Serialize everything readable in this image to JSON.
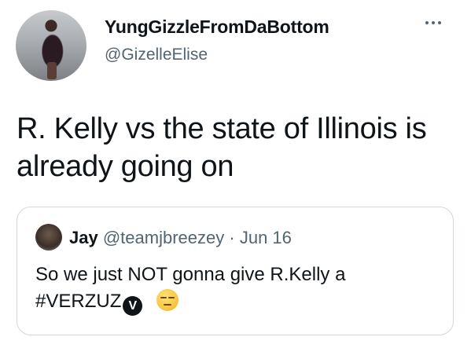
{
  "tweet": {
    "author_name": "YungGizzleFromDaBottom",
    "author_handle": "@GizelleElise",
    "text": "R. Kelly vs the state of Illinois is already going on",
    "avatar_icon": "profile-photo-icon",
    "more_icon": "more-options-icon"
  },
  "quoted_tweet": {
    "author_name": "Jay",
    "author_handle": "@teamjbreezey",
    "separator": "·",
    "date": "Jun 16",
    "text": "So we just NOT gonna give R.Kelly a",
    "hashtag": "#VERZUZ",
    "badge_letter": "V",
    "emoji_name": "unamused-face-emoji",
    "avatar_icon": "profile-photo-icon"
  },
  "colors": {
    "text_primary": "#0f1419",
    "text_secondary": "#536471",
    "border": "#cfd9de"
  }
}
